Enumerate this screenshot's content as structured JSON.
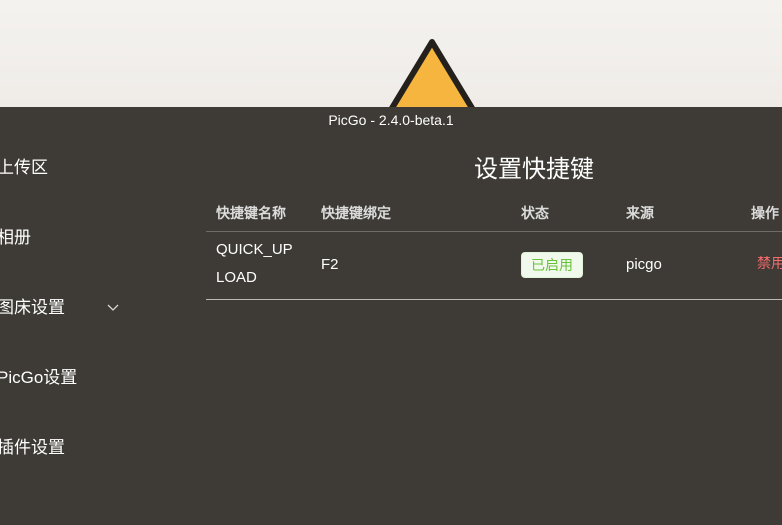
{
  "window": {
    "title": "PicGo - 2.4.0-beta.1"
  },
  "sidebar": {
    "items": [
      {
        "label": "上传区"
      },
      {
        "label": "相册"
      },
      {
        "label": "图床设置"
      },
      {
        "label": "PicGo设置"
      },
      {
        "label": "插件设置"
      }
    ]
  },
  "page": {
    "title": "设置快捷键"
  },
  "table": {
    "headers": [
      "快捷键名称",
      "快捷键绑定",
      "状态",
      "来源",
      "操作"
    ],
    "rows": [
      {
        "name": "QUICK_UPLOAD",
        "binding": "F2",
        "status": "已启用",
        "source": "picgo",
        "action": "禁用"
      }
    ]
  },
  "icons": {
    "sidebar_expand": "chevron-down-icon",
    "background_art": "triangle-icon"
  },
  "colors": {
    "app_background": "#3e3b36",
    "status_enabled": "#67c23a",
    "action_disable": "#f56c6c",
    "background_triangle": "#f5b53f"
  }
}
